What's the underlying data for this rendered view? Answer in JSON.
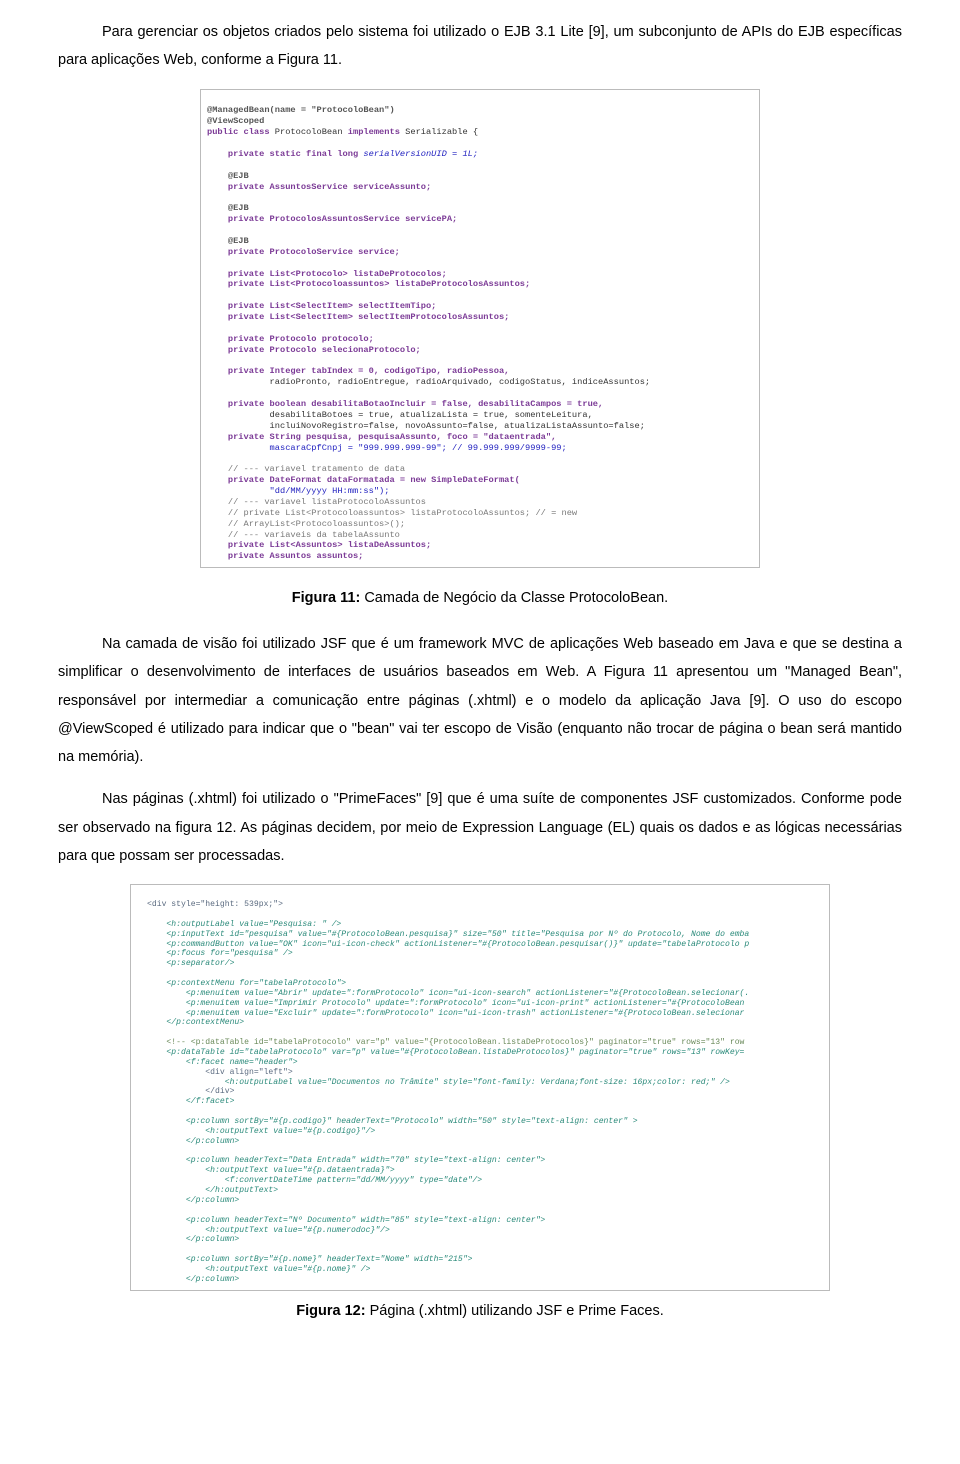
{
  "para1": "Para gerenciar os objetos criados pelo sistema foi utilizado o EJB 3.1 Lite [9], um subconjunto de APIs do EJB específicas para aplicações Web, conforme a Figura 11.",
  "caption1_b": "Figura 11:",
  "caption1_t": " Camada de Negócio da Classe ProtocoloBean.",
  "para2": "Na camada de visão foi utilizado JSF que é um framework MVC de aplicações Web baseado em Java e que se destina a simplificar o desenvolvimento de interfaces de usuários baseados em Web. A Figura 11 apresentou um \"Managed Bean\", responsável por intermediar a comunicação entre páginas (.xhtml) e o modelo da aplicação Java [9]. O uso do escopo @ViewScoped é utilizado para indicar que o \"bean\" vai ter escopo de Visão (enquanto não trocar de página o bean será mantido na memória).",
  "para3": "Nas páginas (.xhtml) foi utilizado o \"PrimeFaces\" [9] que é uma suíte de componentes JSF customizados. Conforme pode ser observado na figura 12. As páginas decidem, por meio de Expression Language (EL) quais os dados e as lógicas necessárias para que possam ser processadas.",
  "caption2_b": "Figura 12:",
  "caption2_t": " Página (.xhtml) utilizando JSF e Prime Faces.",
  "code1": {
    "l01": "@ManagedBean(name = \"ProtocoloBean\")",
    "l02": "@ViewScoped",
    "l03a": "public class ",
    "l03b": "ProtocoloBean ",
    "l03c": "implements ",
    "l03d": "Serializable {",
    "l04a": "    private static final long ",
    "l04b": "serialVersionUID = 1L;",
    "l05": "    @EJB",
    "l06": "    private AssuntosService serviceAssunto;",
    "l07": "    @EJB",
    "l08": "    private ProtocolosAssuntosService servicePA;",
    "l09": "    @EJB",
    "l10": "    private ProtocoloService service;",
    "l11": "    private List<Protocolo> listaDeProtocolos;",
    "l12": "    private List<Protocoloassuntos> listaDeProtocolosAssuntos;",
    "l13": "    private List<SelectItem> selectItemTipo;",
    "l14": "    private List<SelectItem> selectItemProtocolosAssuntos;",
    "l15": "    private Protocolo protocolo;",
    "l16": "    private Protocolo selecionaProtocolo;",
    "l17": "    private Integer tabIndex = 0, codigoTipo, radioPessoa,",
    "l17b": "            radioPronto, radioEntregue, radioArquivado, codigoStatus, indiceAssuntos;",
    "l18": "    private boolean desabilitaBotaoIncluir = false, desabilitaCampos = true,",
    "l18b": "            desabilitaBotoes = true, atualizaLista = true, somenteLeitura,",
    "l18c": "            incluiNovoRegistro=false, novoAssunto=false, atualizaListaAssunto=false;",
    "l19": "    private String pesquisa, pesquisaAssunto, foco = \"dataentrada\",",
    "l19b": "            mascaraCpfCnpj = \"999.999.999-99\"; // 99.999.999/9999-99;",
    "l20": "    // --- variavel tratamento de data",
    "l21": "    private DateFormat dataFormatada = new SimpleDateFormat(",
    "l21b": "            \"dd/MM/yyyy HH:mm:ss\");",
    "l22": "    // --- variavel listaProtocoloAssuntos",
    "l23": "    // private List<Protocoloassuntos> listaProtocoloAssuntos; // = new",
    "l24": "    // ArrayList<Protocoloassuntos>();",
    "l25": "    // --- variaveis da tabelaAssunto",
    "l26": "    private List<Assuntos> listaDeAssuntos;",
    "l27": "    private Assuntos assuntos;"
  },
  "code2": {
    "l01": "<div style=\"height: 539px;\">",
    "l02": "    <h:outputLabel value=\"Pesquisa: \" />",
    "l03": "    <p:inputText id=\"pesquisa\" value=\"#{ProtocoloBean.pesquisa}\" size=\"50\" title=\"Pesquisa por Nº do Protocolo, Nome do emba",
    "l04": "    <p:commandButton value=\"OK\" icon=\"ui-icon-check\" actionListener=\"#{ProtocoloBean.pesquisar()}\" update=\"tabelaProtocolo p",
    "l05": "    <p:focus for=\"pesquisa\" />",
    "l06": "    <p:separator/>",
    "l07": "",
    "l08": "    <p:contextMenu for=\"tabelaProtocolo\">",
    "l09": "        <p:menuitem value=\"Abrir\" update=\":formProtocolo\" icon=\"ui-icon-search\" actionListener=\"#{ProtocoloBean.selecionar(.",
    "l10": "        <p:menuitem value=\"Imprimir Protocolo\" update=\":formProtocolo\" icon=\"ui-icon-print\" actionListener=\"#{ProtocoloBean",
    "l11": "        <p:menuitem value=\"Excluir\" update=\":formProtocolo\" icon=\"ui-icon-trash\" actionListener=\"#{ProtocoloBean.selecionar",
    "l12": "    </p:contextMenu>",
    "l13": "",
    "l14": "    <!-- <p:dataTable id=\"tabelaProtocolo\" var=\"p\" value=\"{ProtocoloBean.listaDeProtocolos}\" paginator=\"true\" rows=\"13\" row",
    "l15": "    <p:dataTable id=\"tabelaProtocolo\" var=\"p\" value=\"#{ProtocoloBean.listaDeProtocolos}\" paginator=\"true\" rows=\"13\" rowKey=",
    "l16": "        <f:facet name=\"header\">",
    "l17": "            <div align=\"left\">",
    "l18": "                <h:outputLabel value=\"Documentos no Trâmite\" style=\"font-family: Verdana;font-size: 16px;color: red;\" />",
    "l19": "            </div>",
    "l20": "        </f:facet>",
    "l21": "",
    "l22": "        <p:column sortBy=\"#{p.codigo}\" headerText=\"Protocolo\" width=\"50\" style=\"text-align: center\" >",
    "l23": "            <h:outputText value=\"#{p.codigo}\"/>",
    "l24": "        </p:column>",
    "l25": "",
    "l26": "        <p:column headerText=\"Data Entrada\" width=\"70\" style=\"text-align: center\">",
    "l27": "            <h:outputText value=\"#{p.dataentrada}\">",
    "l28": "                <f:convertDateTime pattern=\"dd/MM/yyyy\" type=\"date\"/>",
    "l29": "            </h:outputText>",
    "l30": "        </p:column>",
    "l31": "",
    "l32": "        <p:column headerText=\"Nº Documento\" width=\"85\" style=\"text-align: center\">",
    "l33": "            <h:outputText value=\"#{p.numerodoc}\"/>",
    "l34": "        </p:column>",
    "l35": "",
    "l36": "        <p:column sortBy=\"#{p.nome}\" headerText=\"Nome\" width=\"215\">",
    "l37": "            <h:outputText value=\"#{p.nome}\" />",
    "l38": "        </p:column>"
  }
}
